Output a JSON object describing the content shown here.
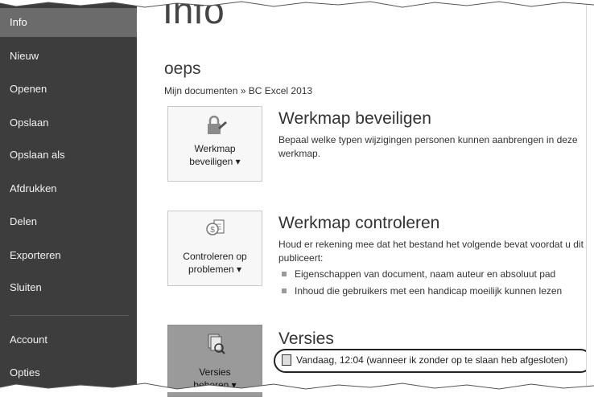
{
  "sidebar": {
    "items": [
      {
        "label": "Info",
        "active": true
      },
      {
        "label": "Nieuw"
      },
      {
        "label": "Openen"
      },
      {
        "label": "Opslaan"
      },
      {
        "label": "Opslaan als"
      },
      {
        "label": "Afdrukken"
      },
      {
        "label": "Delen"
      },
      {
        "label": "Exporteren"
      },
      {
        "label": "Sluiten"
      },
      {
        "label": "Account"
      },
      {
        "label": "Opties"
      }
    ]
  },
  "main": {
    "title": "Info",
    "doc_name": "oeps",
    "doc_path": "Mijn documenten » BC Excel 2013",
    "sections": [
      {
        "button_label_1": "Werkmap",
        "button_label_2": "beveiligen ▾",
        "icon": "lock-icon",
        "title": "Werkmap beveiligen",
        "desc": "Bepaal welke typen wijzigingen personen kunnen aanbrengen in deze werkmap."
      },
      {
        "button_label_1": "Controleren op",
        "button_label_2": "problemen ▾",
        "icon": "inspect-icon",
        "title": "Werkmap controleren",
        "desc": "Houd er rekening mee dat het bestand het volgende bevat voordat u dit publiceert:",
        "bullets": [
          "Eigenschappen van document, naam auteur en absoluut pad",
          "Inhoud die gebruikers met een handicap moeilijk kunnen lezen"
        ]
      },
      {
        "button_label_1": "Versies",
        "button_label_2": "beheren ▾",
        "icon": "versions-icon",
        "title": "Versies",
        "version_entry": "Vandaag, 12:04 (wanneer ik zonder op te slaan heb afgesloten)"
      }
    ]
  },
  "colors": {
    "sidebar_bg": "#3d3d3d",
    "sidebar_active": "#6b6b6b",
    "oval": "#222222"
  }
}
